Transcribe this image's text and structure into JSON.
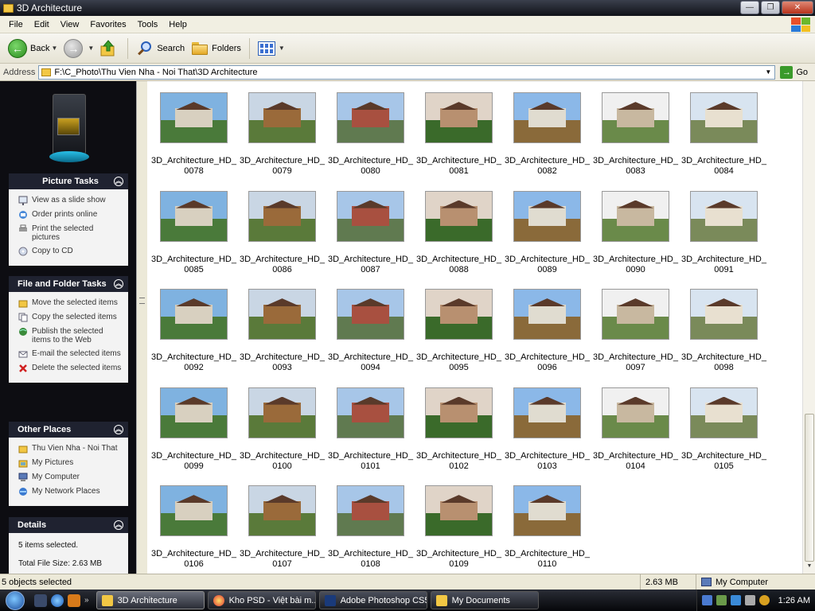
{
  "window": {
    "title": "3D Architecture",
    "controls": {
      "minimize": "—",
      "maximize": "❐",
      "close": "✕"
    }
  },
  "menu": [
    "File",
    "Edit",
    "View",
    "Favorites",
    "Tools",
    "Help"
  ],
  "toolbar": {
    "back_label": "Back",
    "search_label": "Search",
    "folders_label": "Folders"
  },
  "address": {
    "label": "Address",
    "path": "F:\\C_Photo\\Thu Vien Nha - Noi That\\3D Architecture",
    "go_label": "Go"
  },
  "tasks": {
    "picture": {
      "title": "Picture Tasks",
      "items": [
        "View as a slide show",
        "Order prints online",
        "Print the selected pictures",
        "Copy to CD"
      ]
    },
    "file_folder": {
      "title": "File and Folder Tasks",
      "items": [
        "Move the selected items",
        "Copy the selected items",
        "Publish the selected items to the Web",
        "E-mail the selected items",
        "Delete the selected items"
      ]
    },
    "other_places": {
      "title": "Other Places",
      "items": [
        "Thu Vien Nha - Noi That",
        "My Pictures",
        "My Computer",
        "My Network Places"
      ]
    },
    "details": {
      "title": "Details",
      "selected": "5 items selected.",
      "size": "Total File Size: 2.63 MB"
    }
  },
  "files": {
    "prefix": "3D_Architecture_HD_",
    "numbers": [
      "0078",
      "0079",
      "0080",
      "0081",
      "0082",
      "0083",
      "0084",
      "0085",
      "0086",
      "0087",
      "0088",
      "0089",
      "0090",
      "0091",
      "0092",
      "0093",
      "0094",
      "0095",
      "0096",
      "0097",
      "0098",
      "0099",
      "0100",
      "0101",
      "0102",
      "0103",
      "0104",
      "0105",
      "0106",
      "0107",
      "0108",
      "0109",
      "0110"
    ]
  },
  "status": {
    "left": "5 objects selected",
    "size": "2.63 MB",
    "location": "My Computer"
  },
  "taskbar": {
    "quick_more": "»",
    "buttons": [
      "3D Architecture",
      "Kho PSD - Việt bài m...",
      "Adobe Photoshop CS5",
      "My Documents"
    ],
    "clock": "1:26 AM"
  },
  "colors": {
    "task_header": "#1f2230",
    "pane_bg": "#0d0d12",
    "accent_green": "#3a9a2a"
  }
}
